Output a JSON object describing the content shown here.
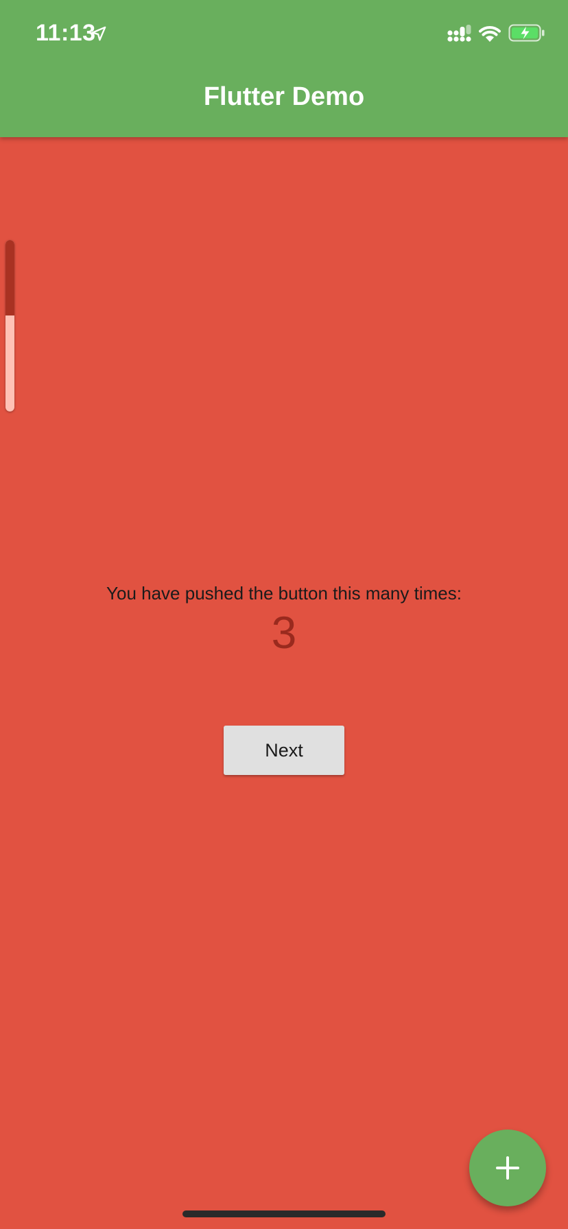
{
  "status_bar": {
    "time": "11:13",
    "icons": [
      "location-arrow-icon",
      "cellular-signal-icon",
      "wifi-icon",
      "battery-charging-icon"
    ]
  },
  "app_bar": {
    "title": "Flutter Demo"
  },
  "scroll_indicator": {
    "progress": 0.44
  },
  "counter": {
    "caption": "You have pushed the button this many times:",
    "value": "3"
  },
  "next_button": {
    "label": "Next"
  },
  "fab": {
    "icon": "plus-icon"
  },
  "colors": {
    "app_bar": "#69AF5D",
    "background": "#E15241",
    "counter_value": "#9A2A1E",
    "button": "#E0E0E0",
    "fab": "#69AF5D"
  }
}
